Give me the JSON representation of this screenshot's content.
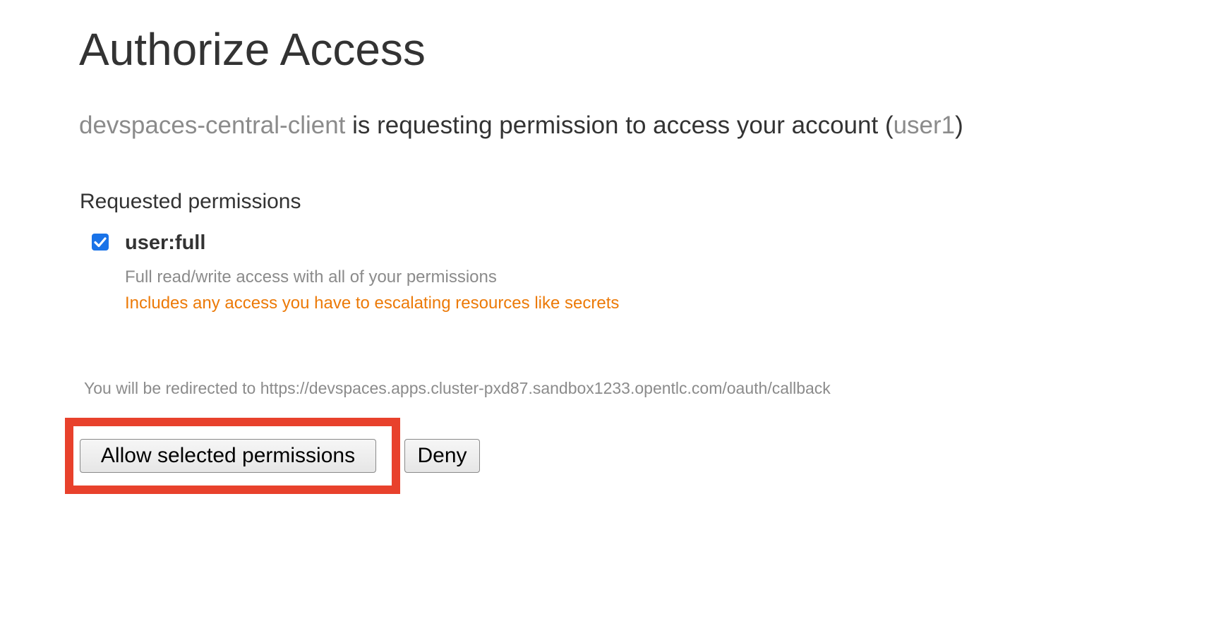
{
  "page": {
    "title": "Authorize Access"
  },
  "request": {
    "client_name": "devspaces-central-client",
    "message": " is requesting permission to access your account (",
    "username": "user1",
    "closing": ")"
  },
  "permissions": {
    "heading": "Requested permissions",
    "items": [
      {
        "name": "user:full",
        "checked": true,
        "description": "Full read/write access with all of your permissions",
        "warning": "Includes any access you have to escalating resources like secrets"
      }
    ]
  },
  "redirect": {
    "text": "You will be redirected to https://devspaces.apps.cluster-pxd87.sandbox1233.opentlc.com/oauth/callback"
  },
  "actions": {
    "allow_label": "Allow selected permissions",
    "deny_label": "Deny"
  },
  "colors": {
    "text": "#333333",
    "muted": "#8b8b8b",
    "warning": "#ec7a08",
    "checkbox": "#1a73e8",
    "highlight": "#e8412c"
  }
}
